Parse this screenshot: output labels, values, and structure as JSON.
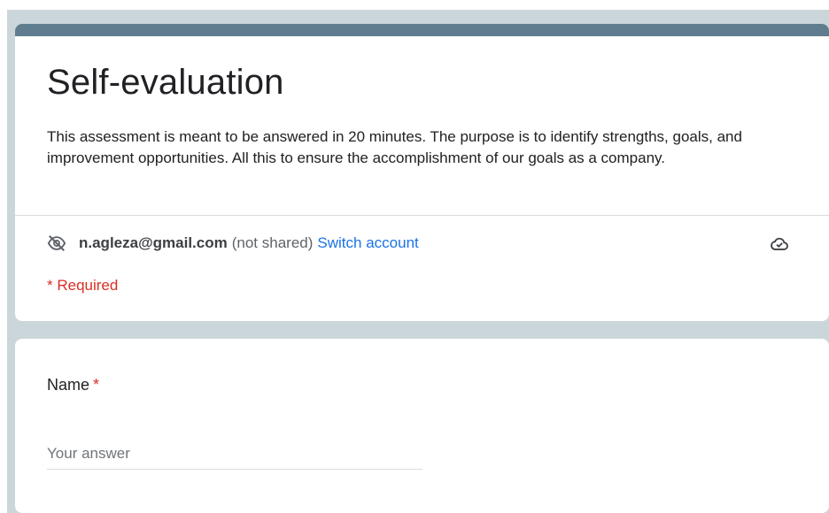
{
  "form": {
    "title": "Self-evaluation",
    "description": "This assessment is meant to be answered in 20 minutes. The purpose is to identify strengths, goals, and improvement opportunities. All this to ensure the accomplishment of our goals as a company.",
    "account": {
      "email": "n.agleza@gmail.com",
      "visibility": "(not shared)",
      "switch_label": "Switch account",
      "icon": "eye-off-icon"
    },
    "save_icon": "cloud-check-icon",
    "required_note": "* Required",
    "accent_color": "#5f7d8e"
  },
  "questions": [
    {
      "label": "Name",
      "required_mark": "*",
      "placeholder": "Your answer",
      "value": ""
    }
  ]
}
